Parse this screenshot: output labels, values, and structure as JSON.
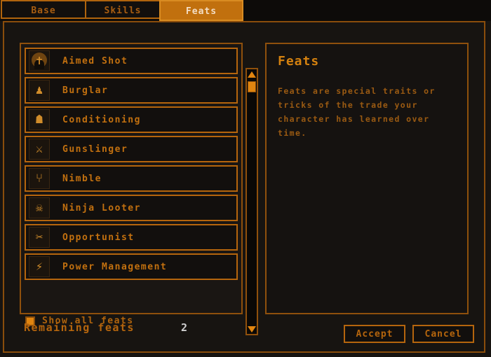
{
  "tabs": [
    {
      "label": "Base",
      "active": false
    },
    {
      "label": "Skills",
      "active": false
    },
    {
      "label": "Feats",
      "active": true
    }
  ],
  "feats_list": [
    {
      "name": "Aimed Shot",
      "icon": "aimed-shot-icon",
      "glyph": "✝"
    },
    {
      "name": "Burglar",
      "icon": "burglar-icon",
      "glyph": "♟"
    },
    {
      "name": "Conditioning",
      "icon": "conditioning-icon",
      "glyph": "☗"
    },
    {
      "name": "Gunslinger",
      "icon": "gunslinger-icon",
      "glyph": "⚔"
    },
    {
      "name": "Nimble",
      "icon": "nimble-icon",
      "glyph": "⑂"
    },
    {
      "name": "Ninja Looter",
      "icon": "ninja-looter-icon",
      "glyph": "☠"
    },
    {
      "name": "Opportunist",
      "icon": "opportunist-icon",
      "glyph": "✂"
    },
    {
      "name": "Power Management",
      "icon": "power-management-icon",
      "glyph": "⚡"
    }
  ],
  "checkbox": {
    "label": "Show all feats",
    "checked": true
  },
  "scrollbar": {
    "up_arrow": "triangle-up",
    "down_arrow": "triangle-down"
  },
  "description": {
    "title": "Feats",
    "body": "Feats are special traits or tricks of the trade your character has learned over time."
  },
  "footer": {
    "remaining_label": "Remaining feats",
    "remaining_value": "2",
    "accept_label": "Accept",
    "cancel_label": "Cancel"
  },
  "colors": {
    "accent": "#c1700e",
    "border": "#b5650d",
    "text": "#b0640d",
    "active_tab_text": "#f3ddc4",
    "background": "#171411",
    "value_text": "#cfcfcf"
  }
}
